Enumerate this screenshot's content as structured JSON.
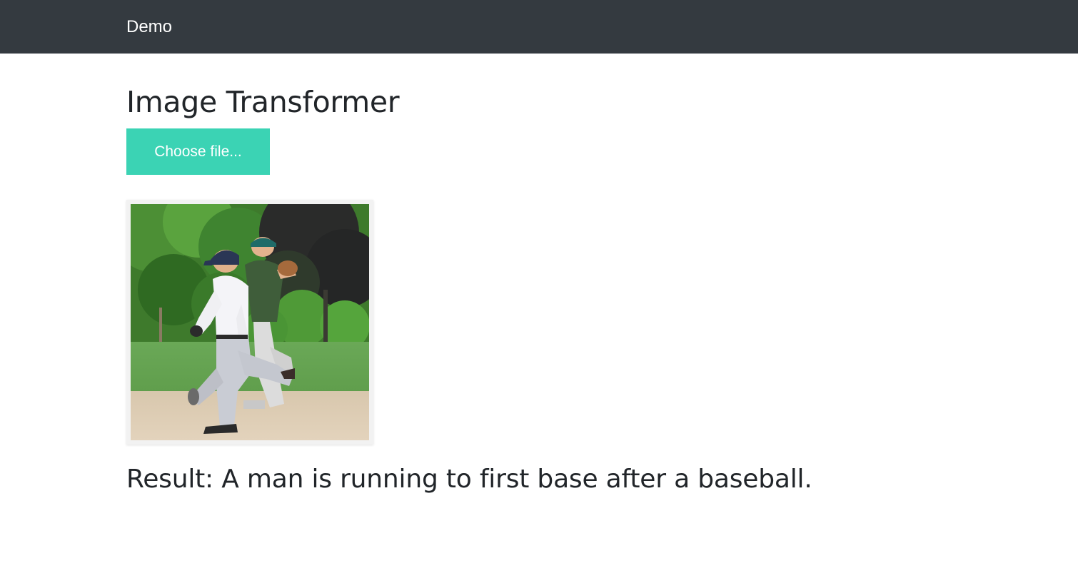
{
  "navbar": {
    "brand": "Demo",
    "background_color": "#343a40"
  },
  "main": {
    "title": "Image Transformer",
    "upload_button_label": "Choose file...",
    "upload_button_color": "#3bd3b4",
    "result_label": "Result:",
    "result_text": "A man is running to first base after a baseball."
  }
}
